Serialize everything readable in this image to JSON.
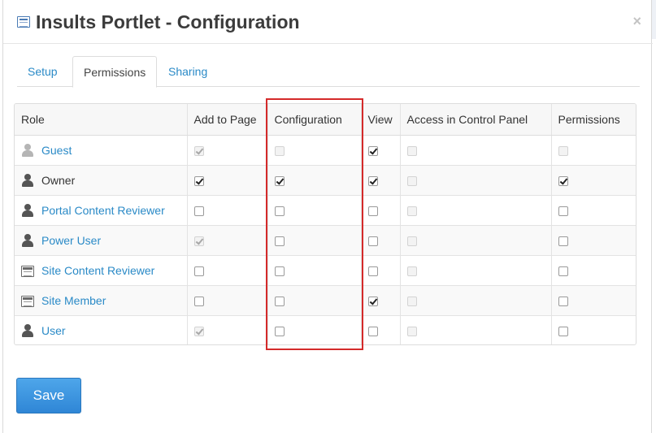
{
  "dialog": {
    "title": "Insults Portlet - Configuration",
    "close_symbol": "×"
  },
  "tabs": [
    {
      "label": "Setup",
      "active": false
    },
    {
      "label": "Permissions",
      "active": true
    },
    {
      "label": "Sharing",
      "active": false
    }
  ],
  "table": {
    "headers": [
      "Role",
      "Add to Page",
      "Configuration",
      "View",
      "Access in Control Panel",
      "Permissions"
    ],
    "rows": [
      {
        "role": "Guest",
        "icon": "user-light-icon",
        "link": true,
        "cells": [
          {
            "checked": true,
            "disabled": true
          },
          {
            "checked": false,
            "disabled": true
          },
          {
            "checked": true,
            "disabled": false
          },
          {
            "checked": false,
            "disabled": true
          },
          {
            "checked": false,
            "disabled": true
          }
        ]
      },
      {
        "role": "Owner",
        "icon": "user-icon",
        "link": false,
        "cells": [
          {
            "checked": true,
            "disabled": false
          },
          {
            "checked": true,
            "disabled": false
          },
          {
            "checked": true,
            "disabled": false
          },
          {
            "checked": false,
            "disabled": true
          },
          {
            "checked": true,
            "disabled": false
          }
        ]
      },
      {
        "role": "Portal Content Reviewer",
        "icon": "user-icon",
        "link": true,
        "cells": [
          {
            "checked": false,
            "disabled": false
          },
          {
            "checked": false,
            "disabled": false
          },
          {
            "checked": false,
            "disabled": false
          },
          {
            "checked": false,
            "disabled": true
          },
          {
            "checked": false,
            "disabled": false
          }
        ]
      },
      {
        "role": "Power User",
        "icon": "user-icon",
        "link": true,
        "cells": [
          {
            "checked": true,
            "disabled": true
          },
          {
            "checked": false,
            "disabled": false
          },
          {
            "checked": false,
            "disabled": false
          },
          {
            "checked": false,
            "disabled": true
          },
          {
            "checked": false,
            "disabled": false
          }
        ]
      },
      {
        "role": "Site Content Reviewer",
        "icon": "site-icon",
        "link": true,
        "cells": [
          {
            "checked": false,
            "disabled": false
          },
          {
            "checked": false,
            "disabled": false
          },
          {
            "checked": false,
            "disabled": false
          },
          {
            "checked": false,
            "disabled": true
          },
          {
            "checked": false,
            "disabled": false
          }
        ]
      },
      {
        "role": "Site Member",
        "icon": "site-icon",
        "link": true,
        "cells": [
          {
            "checked": false,
            "disabled": false
          },
          {
            "checked": false,
            "disabled": false
          },
          {
            "checked": true,
            "disabled": false
          },
          {
            "checked": false,
            "disabled": true
          },
          {
            "checked": false,
            "disabled": false
          }
        ]
      },
      {
        "role": "User",
        "icon": "user-icon",
        "link": true,
        "cells": [
          {
            "checked": true,
            "disabled": true
          },
          {
            "checked": false,
            "disabled": false
          },
          {
            "checked": false,
            "disabled": false
          },
          {
            "checked": false,
            "disabled": true
          },
          {
            "checked": false,
            "disabled": false
          }
        ]
      }
    ]
  },
  "save_button": {
    "label": "Save"
  },
  "colors": {
    "link": "#2a8ac7",
    "highlight": "#d42a2a",
    "save_button": "#3a93de"
  }
}
